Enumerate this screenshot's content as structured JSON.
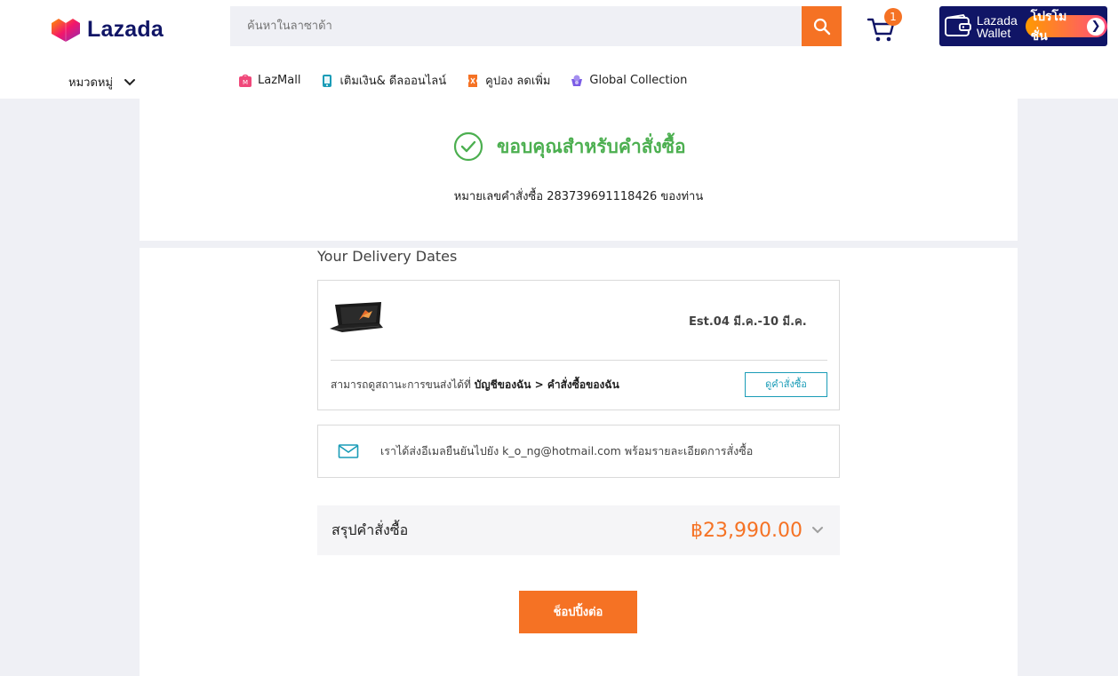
{
  "header": {
    "logo_text": "Lazada",
    "search_placeholder": "ค้นหาในลาซาด้า",
    "cart_count": "1",
    "wallet_line1": "Lazada",
    "wallet_line2": "Wallet",
    "wallet_promo": "โปรโมชั่น",
    "category_label": "หมวดหมู่",
    "nav": [
      {
        "label": "LazMall",
        "icon": "lazmall-icon",
        "color": "#f0487a"
      },
      {
        "label": "เติมเงิน& ดีลออนไลน์",
        "icon": "topup-icon",
        "color": "#1a9cb7"
      },
      {
        "label": "คูปอง ลดเพิ่ม",
        "icon": "coupon-icon",
        "color": "#f57224"
      },
      {
        "label": "Global Collection",
        "icon": "global-icon",
        "color": "#7b5ce6"
      }
    ]
  },
  "confirmation": {
    "title": "ขอบคุณสำหรับคำสั่งซื้อ",
    "order_prefix": "หมายเลขคำสั่งซื้อ",
    "order_number": "283739691118426",
    "order_suffix": "ของท่าน"
  },
  "delivery": {
    "title": "Your Delivery Dates",
    "estimate": "Est.04 มี.ค.-10 มี.ค.",
    "status_prefix": "สามารถดูสถานะการขนส่งได้ที่",
    "status_path": "บัญชีของฉัน > คำสั่งซื้อของฉัน",
    "view_order_label": "ดูคำสั่งซื้อ"
  },
  "email": {
    "text": "เราได้ส่งอีเมลยืนยันไปยัง k_o_ng@hotmail.com พร้อมรายละเอียดการสั่งซื้อ"
  },
  "summary": {
    "label": "สรุปคำสั่งซื้อ",
    "total": "฿23,990.00"
  },
  "continue_label": "ช็อปปิ้งต่อ",
  "colors": {
    "brand_orange": "#f57224",
    "brand_navy": "#101566",
    "success_green": "#4caf50",
    "link_teal": "#1a9cb7"
  }
}
